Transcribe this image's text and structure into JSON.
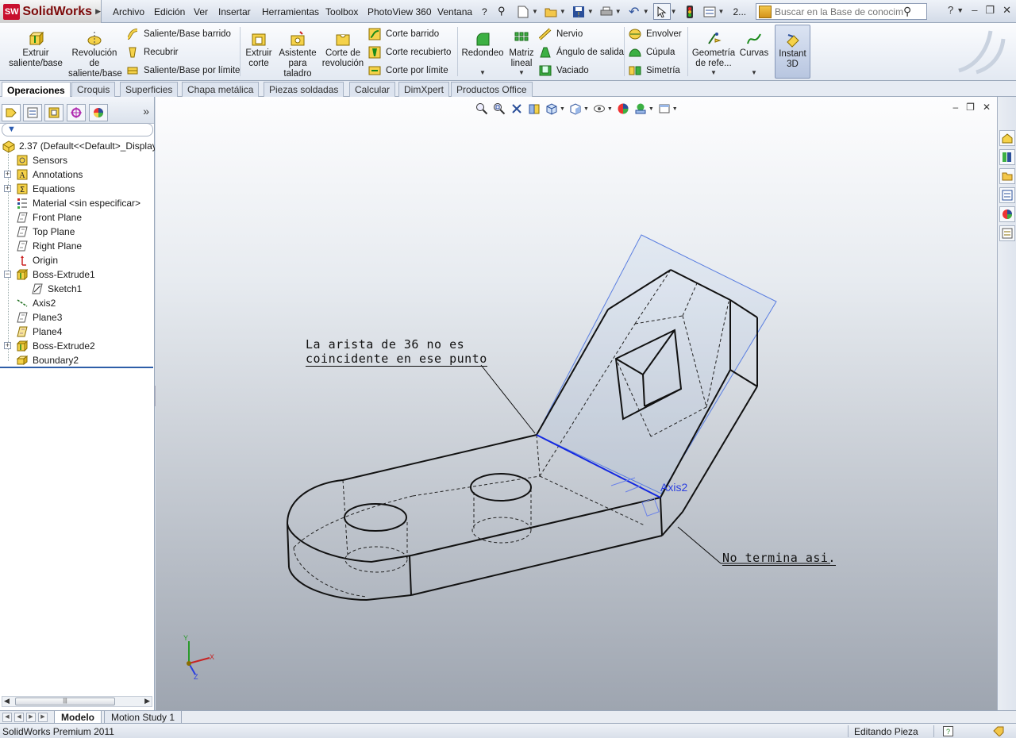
{
  "app": {
    "logo_badge": "SW",
    "logo_text": "SolidWorks"
  },
  "menu": [
    "Archivo",
    "Edición",
    "Ver",
    "Insertar",
    "Herramientas",
    "Toolbox",
    "PhotoView 360",
    "Ventana",
    "?"
  ],
  "search": {
    "placeholder": "Buscar en la Base de conocimien"
  },
  "quick_access_overflow": "2...",
  "ribbon": {
    "extruir_saliente": "Extruir saliente/base",
    "revolucion_saliente": "Revolución de saliente/base",
    "saliente_barrido": "Saliente/Base barrido",
    "recubrir": "Recubrir",
    "saliente_limite": "Saliente/Base por límite",
    "extruir_corte": "Extruir corte",
    "asistente_taladro": "Asistente para taladro",
    "corte_revolucion": "Corte de revolución",
    "corte_barrido": "Corte barrido",
    "corte_recubierto": "Corte recubierto",
    "corte_limite": "Corte por límite",
    "redondeo": "Redondeo",
    "matriz_lineal": "Matriz lineal",
    "nervio": "Nervio",
    "angulo_salida": "Ángulo de salida",
    "vaciado": "Vaciado",
    "envolver": "Envolver",
    "cupula": "Cúpula",
    "simetria": "Simetría",
    "geometria_ref": "Geometría de refe...",
    "curvas": "Curvas",
    "instant3d": "Instant 3D"
  },
  "tabs": [
    "Operaciones",
    "Croquis",
    "Superficies",
    "Chapa metálica",
    "Piezas soldadas",
    "Calcular",
    "DimXpert",
    "Productos Office"
  ],
  "tree": {
    "root": "2.37  (Default<<Default>_Display",
    "items": [
      {
        "label": "Sensors",
        "icon": "sensor-icon"
      },
      {
        "label": "Annotations",
        "icon": "annotations-icon"
      },
      {
        "label": "Equations",
        "icon": "equations-icon"
      },
      {
        "label": "Material <sin especificar>",
        "icon": "material-icon"
      },
      {
        "label": "Front Plane",
        "icon": "plane-icon"
      },
      {
        "label": "Top Plane",
        "icon": "plane-icon"
      },
      {
        "label": "Right Plane",
        "icon": "plane-icon"
      },
      {
        "label": "Origin",
        "icon": "origin-icon"
      },
      {
        "label": "Boss-Extrude1",
        "icon": "extrude-icon"
      },
      {
        "label": "Sketch1",
        "icon": "sketch-icon"
      },
      {
        "label": "Axis2",
        "icon": "axis-icon"
      },
      {
        "label": "Plane3",
        "icon": "plane-icon"
      },
      {
        "label": "Plane4",
        "icon": "plane-icon"
      },
      {
        "label": "Boss-Extrude2",
        "icon": "extrude-icon"
      },
      {
        "label": "Boundary2",
        "icon": "boundary-icon"
      }
    ]
  },
  "viewport": {
    "note1_line1": "La arista de 36 no es",
    "note1_line2": "coincidente en ese punto",
    "note2": "No termina asi.",
    "axis_label": "Axis2",
    "triad_x": "X",
    "triad_y": "Y",
    "triad_z": "Z"
  },
  "bottom_tabs": [
    "Modelo",
    "Motion Study 1"
  ],
  "status": {
    "left": "SolidWorks Premium 2011",
    "right": "Editando Pieza"
  },
  "colors": {
    "accent": "#2e5ea8",
    "axis_blue": "#2a3ee0",
    "logo_red": "#c8102e"
  }
}
